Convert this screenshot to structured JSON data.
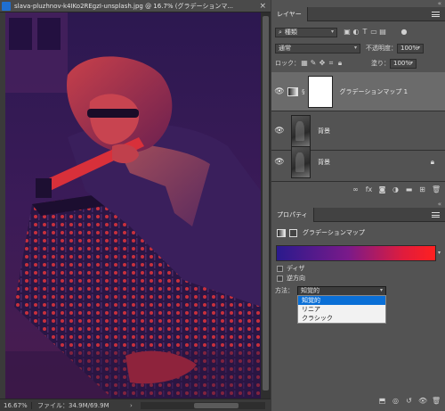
{
  "document": {
    "tab_title": "slava-pluzhnov-k4IKo2REgzI-unsplash.jpg @ 16.7% (グラデーションマ...",
    "close_glyph": "×",
    "status": {
      "zoom": "16.67%",
      "file_info": "ファイル：34.9M/69.9M",
      "arrow": "›"
    }
  },
  "layers_panel": {
    "tab": "レイヤー",
    "collapse_glyph": "«",
    "search": {
      "value": "種類",
      "placeholder": "種類"
    },
    "blend_mode": "通常",
    "opacity_label": "不透明度：",
    "opacity_value": "100%",
    "lock_label": "ロック：",
    "fill_label": "塗り：",
    "fill_value": "100%",
    "layers": [
      {
        "name": "グラデーションマップ 1",
        "selected": true
      },
      {
        "name": "背景",
        "selected": false
      },
      {
        "name": "背景",
        "selected": false
      }
    ],
    "footer_icons": [
      "link-icon",
      "fx-icon",
      "mask-icon",
      "adjustment-icon",
      "group-icon",
      "new-layer-icon",
      "trash-icon"
    ]
  },
  "properties_panel": {
    "tab": "プロパティ",
    "title": "グラデーションマップ",
    "gradient": {
      "from": "#2a1a8c",
      "to": "#ff2020"
    },
    "dither_label": "ディザ",
    "reverse_label": "逆方向",
    "method_label": "方法：",
    "method_value": "知覚的",
    "method_options": [
      {
        "label": "知覚的",
        "active": true
      },
      {
        "label": "リニア",
        "active": false
      },
      {
        "label": "クラシック",
        "active": false
      }
    ]
  },
  "colors": {
    "accent": "#0a6fd6",
    "panel_bg": "#535353",
    "canvas_dark": "#3a1a52",
    "canvas_red": "#e0303a"
  }
}
